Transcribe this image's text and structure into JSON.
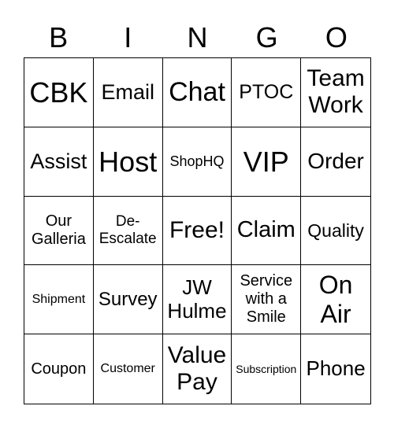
{
  "header": [
    "B",
    "I",
    "N",
    "G",
    "O"
  ],
  "cells": [
    [
      "CBK",
      "Email",
      "Chat",
      "PTOC",
      "Team Work"
    ],
    [
      "Assist",
      "Host",
      "ShopHQ",
      "VIP",
      "Order"
    ],
    [
      "Our Galleria",
      "De-Escalate",
      "Free!",
      "Claim",
      "Quality"
    ],
    [
      "Shipment",
      "Survey",
      "JW Hulme",
      "Service with a Smile",
      "On Air"
    ],
    [
      "Coupon",
      "Customer",
      "Value Pay",
      "Subscription",
      "Phone"
    ]
  ]
}
